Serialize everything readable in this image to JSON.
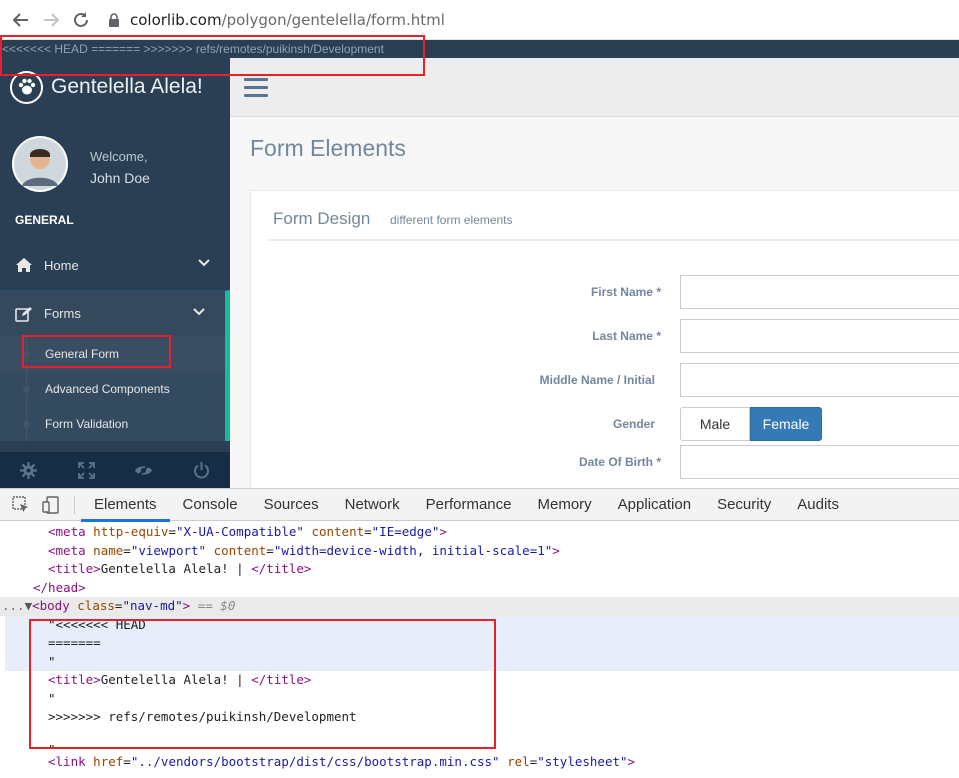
{
  "browser": {
    "url_host": "colorlib.com",
    "url_path": "/polygon/gentelella/form.html"
  },
  "conflict_banner": "<<<<<<< HEAD ======= >>>>>>> refs/remotes/puikinsh/Development",
  "sidebar": {
    "brand": "Gentelella Alela!",
    "welcome": "Welcome,",
    "username": "John Doe",
    "section": "GENERAL",
    "items": [
      {
        "label": "Home",
        "icon": "home-icon"
      },
      {
        "label": "Forms",
        "icon": "edit-icon"
      }
    ],
    "subitems": [
      {
        "label": "General Form"
      },
      {
        "label": "Advanced Components"
      },
      {
        "label": "Form Validation"
      }
    ],
    "footer_icons": [
      "settings-icon",
      "fullscreen-icon",
      "lock-icon",
      "logout-icon"
    ]
  },
  "main": {
    "page_title": "Form Elements",
    "panel_title": "Form Design",
    "panel_subtitle": "different form elements",
    "fields": [
      {
        "label": "First Name",
        "required": "*"
      },
      {
        "label": "Last Name",
        "required": "*"
      },
      {
        "label": "Middle Name / Initial",
        "required": ""
      },
      {
        "label": "Gender",
        "required": ""
      },
      {
        "label": "Date Of Birth",
        "required": "*"
      }
    ],
    "gender_options": {
      "male": "Male",
      "female": "Female",
      "selected": "Female"
    }
  },
  "devtools": {
    "tabs": [
      "Elements",
      "Console",
      "Sources",
      "Network",
      "Performance",
      "Memory",
      "Application",
      "Security",
      "Audits"
    ],
    "active_tab": "Elements",
    "code": {
      "l1_tag_open": "<meta",
      "l1_attr1": "http-equiv",
      "l1_val1": "\"X-UA-Compatible\"",
      "l1_attr2": "content",
      "l1_val2": "\"IE=edge\"",
      "l1_close": ">",
      "l2_tag_open": "<meta",
      "l2_attr1": "name",
      "l2_val1": "\"viewport\"",
      "l2_attr2": "content",
      "l2_val2": "\"width=device-width, initial-scale=1\"",
      "l2_close": ">",
      "l3_open": "<title>",
      "l3_text": "Gentelella Alela! | ",
      "l3_close": "</title>",
      "l4": "</head>",
      "l5_dots": "...",
      "l5_open": "<body",
      "l5_attr": "class",
      "l5_val": "\"nav-md\"",
      "l5_close": ">",
      "l5_eq": " == $0",
      "l6": "\"<<<<<<< HEAD",
      "l7": "=======",
      "l8": "\"",
      "l9_open": "<title>",
      "l9_text": "Gentelella Alela! | ",
      "l9_close": "</title>",
      "l10": "\"",
      "l11": ">>>>>>> refs/remotes/puikinsh/Development",
      "l12": "\"",
      "l13_open": "<link",
      "l13_attr1": "href",
      "l13_val1": "\"../vendors/bootstrap/dist/css/bootstrap.min.css\"",
      "l13_attr2": "rel",
      "l13_val2": "\"stylesheet\"",
      "l13_close": ">"
    }
  },
  "colors": {
    "sidebar_bg": "#2a3f54",
    "accent_green": "#1abb9c",
    "primary_blue": "#337ab7",
    "highlight_red": "#e8202b"
  }
}
